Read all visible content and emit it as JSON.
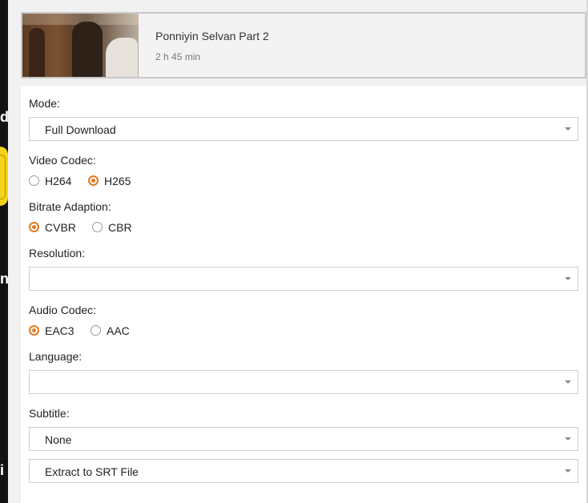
{
  "movie": {
    "title": "Ponniyin Selvan Part 2",
    "duration": "2 h 45 min"
  },
  "form": {
    "mode": {
      "label": "Mode:",
      "value": "Full Download"
    },
    "video_codec": {
      "label": "Video Codec:",
      "options": [
        {
          "label": "H264",
          "checked": false
        },
        {
          "label": "H265",
          "checked": true
        }
      ]
    },
    "bitrate": {
      "label": "Bitrate Adaption:",
      "options": [
        {
          "label": "CVBR",
          "checked": true
        },
        {
          "label": "CBR",
          "checked": false
        }
      ]
    },
    "resolution": {
      "label": "Resolution:",
      "value": ""
    },
    "audio_codec": {
      "label": "Audio Codec:",
      "options": [
        {
          "label": "EAC3",
          "checked": true
        },
        {
          "label": "AAC",
          "checked": false
        }
      ]
    },
    "language": {
      "label": "Language:",
      "value": ""
    },
    "subtitle": {
      "label": "Subtitle:",
      "value": "None",
      "extract_value": "Extract to SRT File"
    }
  },
  "left_strip_fragments": [
    "d",
    "n",
    "i"
  ],
  "colors": {
    "accent": "#e07b1f"
  }
}
